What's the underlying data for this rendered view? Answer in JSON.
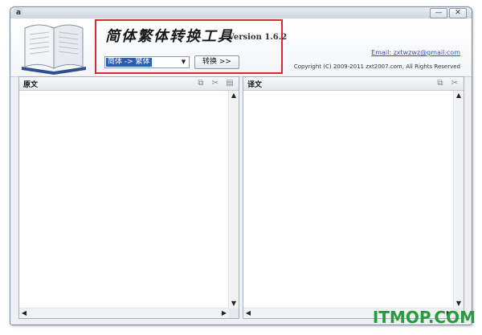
{
  "window": {
    "app_icon": "app-icon",
    "controls": {
      "minimize": "—",
      "close": "✕"
    }
  },
  "header": {
    "title": "简体繁体转换工具",
    "version": "Version 1.6.2",
    "mode_select": {
      "value": "简体 -> 繁体"
    },
    "convert_button": "转换 >>",
    "email": "Email: zxtwzwz@gmail.com",
    "copyright": "Copyright (C) 2009-2011 zxt2007.com, All Rights Reserved"
  },
  "panes": {
    "source": {
      "title": "原文",
      "tools": [
        "copy-icon",
        "cut-icon",
        "paste-icon"
      ]
    },
    "target": {
      "title": "译文",
      "tools": [
        "copy-icon",
        "cut-icon"
      ]
    }
  },
  "scroll": {
    "up": "▲",
    "down": "▼",
    "left": "◀",
    "right": "▶"
  },
  "watermark": "ITMOP.COM",
  "colors": {
    "highlight_border": "#d02a34",
    "watermark": "#2a9a3e",
    "link": "#2a55b5",
    "selection": "#2f5ea8"
  }
}
